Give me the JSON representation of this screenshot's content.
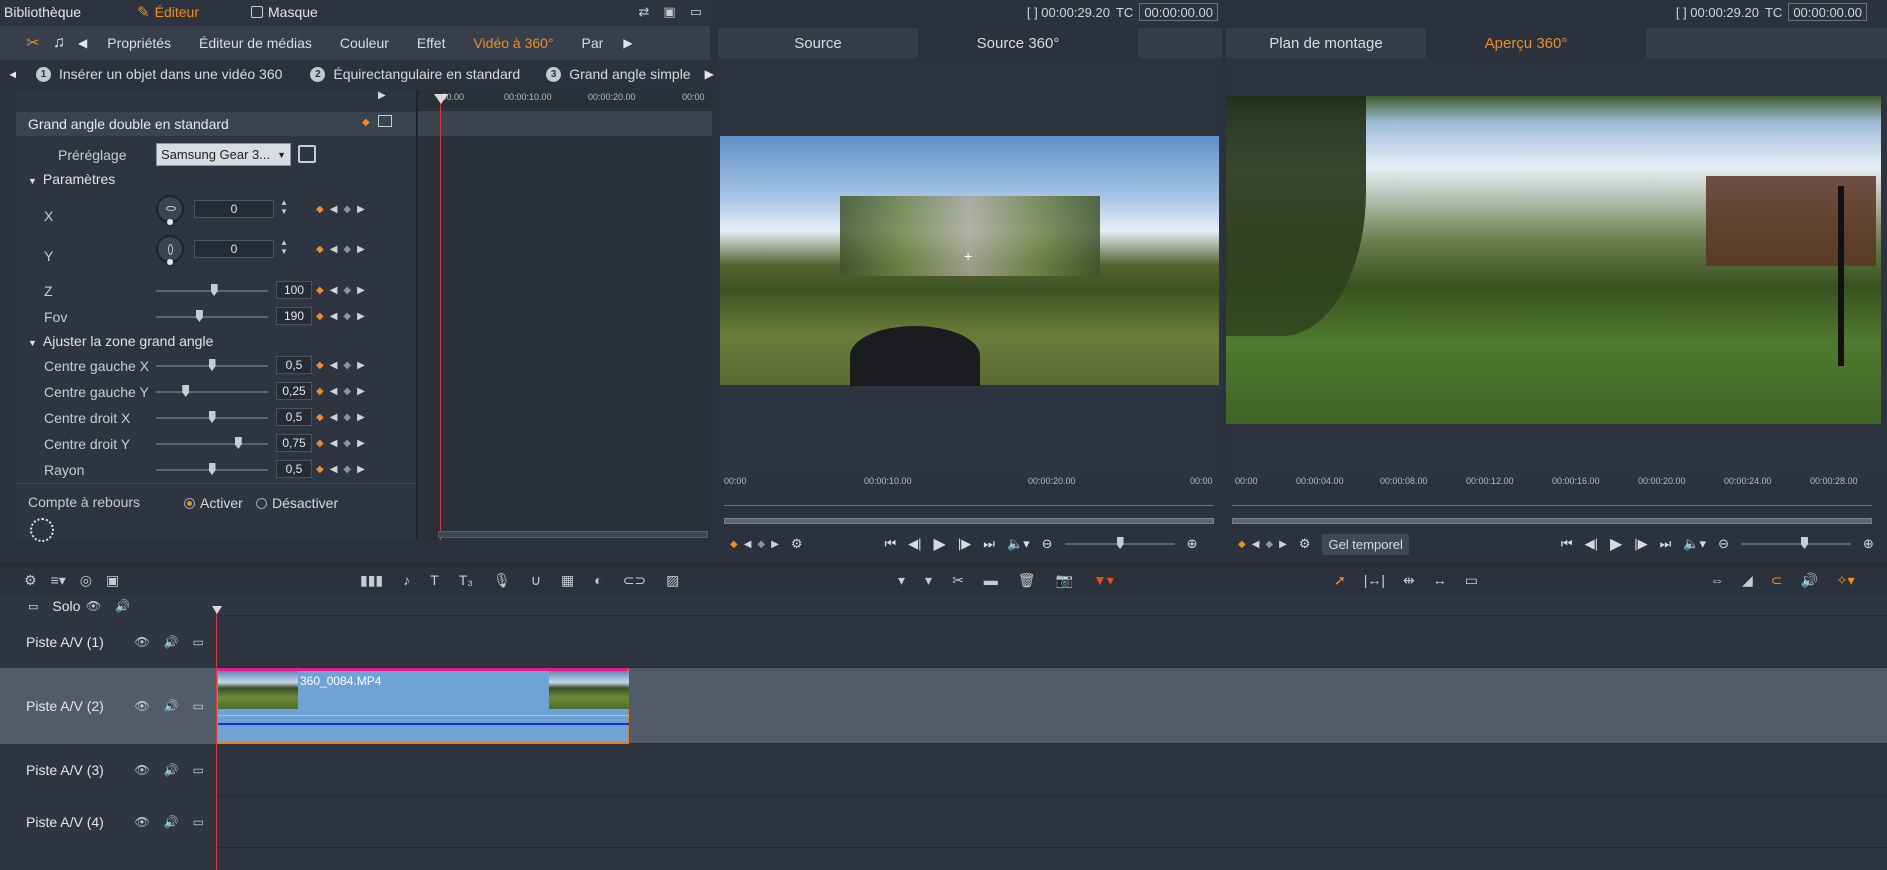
{
  "topbar": {
    "items": [
      {
        "label": "Bibliothèque",
        "active": false
      },
      {
        "label": "Éditeur",
        "active": true
      },
      {
        "label": "Masque",
        "active": false
      }
    ]
  },
  "editor_tabs": [
    "Propriétés",
    "Éditeur de médias",
    "Couleur",
    "Effet",
    "Vidéo à 360°",
    "Par"
  ],
  "editor_active_tab": "Vidéo à 360°",
  "steps": [
    {
      "num": "1",
      "label": "Insérer un objet dans une vidéo 360"
    },
    {
      "num": "2",
      "label": "Équirectangulaire en standard"
    },
    {
      "num": "3",
      "label": "Grand angle simple"
    }
  ],
  "settings": {
    "title": "Grand angle double en standard",
    "preset_label": "Préréglage",
    "preset_value": "Samsung Gear 3...",
    "section_params": "Paramètres",
    "x_label": "X",
    "x_value": "0",
    "y_label": "Y",
    "y_value": "0",
    "z_label": "Z",
    "z_value": "100",
    "z_fraction": 0.52,
    "fov_label": "Fov",
    "fov_value": "190",
    "fov_fraction": 0.38,
    "section_zone": "Ajuster la zone grand angle",
    "centre_gauche_x_label": "Centre gauche X",
    "centre_gauche_x_value": "0,5",
    "centre_gauche_x_fraction": 0.5,
    "centre_gauche_y_label": "Centre gauche Y",
    "centre_gauche_y_value": "0,25",
    "centre_gauche_y_fraction": 0.25,
    "centre_droit_x_label": "Centre droit X",
    "centre_droit_x_value": "0,5",
    "centre_droit_x_fraction": 0.5,
    "centre_droit_y_label": "Centre droit Y",
    "centre_droit_y_value": "0,75",
    "centre_droit_y_fraction": 0.75,
    "rayon_label": "Rayon",
    "rayon_value": "0,5",
    "rayon_fraction": 0.5,
    "countdown_label": "Compte à rebours",
    "activate_label": "Activer",
    "deactivate_label": "Désactiver",
    "countdown_selected": "Activer"
  },
  "kf_ruler": [
    ":00.00",
    "00:00:10.00",
    "00:00:20.00",
    "00:00"
  ],
  "source_viewer": {
    "timecode": "[ ] 00:00:29.20",
    "tc_label": "TC",
    "tc_value": "00:00:00.00",
    "tabs": [
      "Source",
      "Source 360°"
    ],
    "ruler": [
      "00:00",
      "00:00:10.00",
      "00:00:20.00",
      "00:00"
    ]
  },
  "timeline_viewer": {
    "timecode": "[ ] 00:00:29.20",
    "tc_label": "TC",
    "tc_value": "00:00:00.00",
    "tabs": [
      "Plan de montage",
      "Aperçu 360°"
    ],
    "ruler": [
      "00:00",
      "00:00:04.00",
      "00:00:08.00",
      "00:00:12.00",
      "00:00:16.00",
      "00:00:20.00",
      "00:00:24.00",
      "00:00:28.00"
    ],
    "freeze_label": "Gel temporel"
  },
  "timeline": {
    "solo_label": "Solo",
    "tracks": [
      "Piste A/V (1)",
      "Piste A/V (2)",
      "Piste A/V (3)",
      "Piste A/V (4)"
    ],
    "clip_name": "360_0084.MP4"
  },
  "colors": {
    "accent": "#f08d1f",
    "clip": "#6fa3d6",
    "clip_border": "#e0811f",
    "clip_top": "#e01f8c"
  }
}
